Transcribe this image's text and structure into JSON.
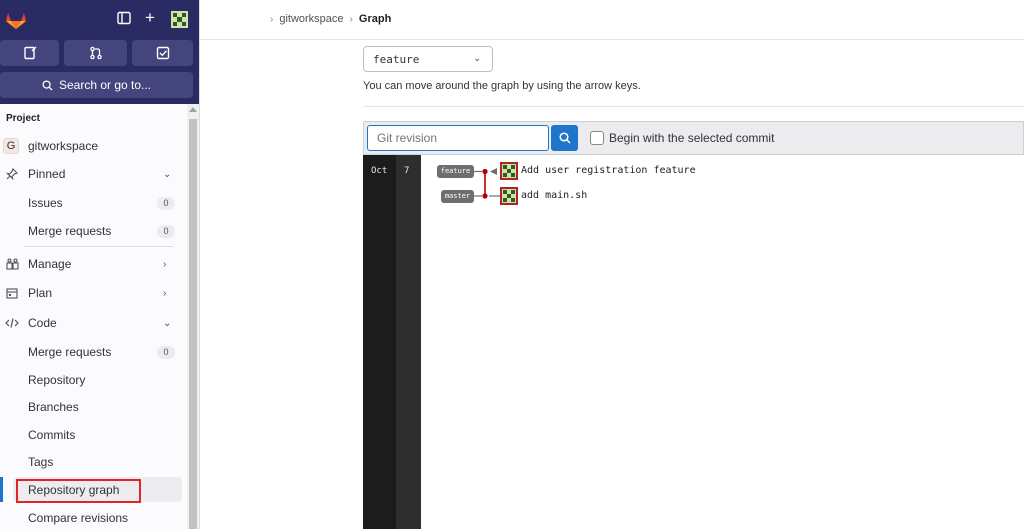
{
  "icons": {
    "brand_logo": "tanuki-logo-icon",
    "sidebar_toggle": "sidebar-toggle-icon",
    "new": "plus-icon",
    "user_avatar": "user-avatar-icon",
    "issues": "issues-icon",
    "merge_requests": "merge-request-icon",
    "todos": "todo-icon",
    "search": "search-icon"
  },
  "colors": {
    "topbar": "#2b2b63",
    "accent": "#1f75cb",
    "highlight": "#e0242b",
    "graph_branch": "#b40000"
  },
  "sidebar": {
    "search_label": "Search or go to...",
    "section_title": "Project",
    "project_letter": "G",
    "project_name": "gitworkspace",
    "pinned": {
      "label": "Pinned",
      "items": [
        {
          "label": "Issues",
          "count": "0"
        },
        {
          "label": "Merge requests",
          "count": "0"
        }
      ]
    },
    "manage": "Manage",
    "plan": "Plan",
    "code": {
      "label": "Code",
      "items": [
        {
          "label": "Merge requests",
          "count": "0"
        },
        {
          "label": "Repository"
        },
        {
          "label": "Branches"
        },
        {
          "label": "Commits"
        },
        {
          "label": "Tags"
        },
        {
          "label": "Repository graph"
        },
        {
          "label": "Compare revisions"
        }
      ]
    }
  },
  "breadcrumb": {
    "project": "gitworkspace",
    "page": "Graph"
  },
  "graph_page": {
    "branch_selected": "feature",
    "hint": "You can move around the graph by using the arrow keys.",
    "revision_placeholder": "Git revision",
    "begin_label": "Begin with the selected commit",
    "month": "Oct",
    "day": "7",
    "commits": [
      {
        "ref": "feature",
        "message": "Add user registration feature"
      },
      {
        "ref": "master",
        "message": "add main.sh"
      }
    ]
  }
}
